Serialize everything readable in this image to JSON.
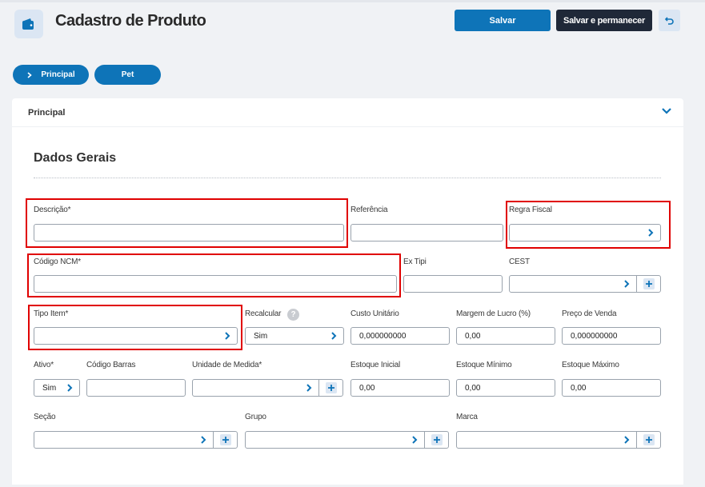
{
  "header": {
    "title": "Cadastro de Produto",
    "save_label": "Salvar",
    "save_stay_label": "Salvar e permanecer",
    "logo_icon": "wallet-icon",
    "back_icon": "undo-icon"
  },
  "tabs": [
    {
      "label": "Principal",
      "active": true
    },
    {
      "label": "Pet",
      "active": false
    }
  ],
  "section": {
    "label": "Principal",
    "title": "Dados Gerais"
  },
  "fields": {
    "descricao": {
      "label": "Descrição*",
      "value": ""
    },
    "referencia": {
      "label": "Referência",
      "value": ""
    },
    "regra_fiscal": {
      "label": "Regra Fiscal",
      "value": ""
    },
    "codigo_ncm": {
      "label": "Código NCM*",
      "value": ""
    },
    "ex_tipi": {
      "label": "Ex Tipi",
      "value": ""
    },
    "cest": {
      "label": "CEST",
      "value": ""
    },
    "tipo_item": {
      "label": "Tipo Item*",
      "value": ""
    },
    "recalcular": {
      "label": "Recalcular",
      "value": "Sim",
      "help": "?"
    },
    "custo_unitario": {
      "label": "Custo Unitário",
      "value": "0,000000000"
    },
    "margem_lucro": {
      "label": "Margem de Lucro (%)",
      "value": "0,00"
    },
    "preco_venda": {
      "label": "Preço de Venda",
      "value": "0,000000000"
    },
    "ativo": {
      "label": "Ativo*",
      "value": "Sim"
    },
    "codigo_barras": {
      "label": "Código Barras",
      "value": ""
    },
    "unidade_medida": {
      "label": "Unidade de Medida*",
      "value": ""
    },
    "estoque_inicial": {
      "label": "Estoque Inicial",
      "value": "0,00"
    },
    "estoque_minimo": {
      "label": "Estoque Mínimo",
      "value": "0,00"
    },
    "estoque_maximo": {
      "label": "Estoque Máximo",
      "value": "0,00"
    },
    "secao": {
      "label": "Seção",
      "value": ""
    },
    "grupo": {
      "label": "Grupo",
      "value": ""
    },
    "marca": {
      "label": "Marca",
      "value": ""
    }
  },
  "colors": {
    "primary": "#0e74b8",
    "dark": "#1f2838",
    "highlight": "#e00000"
  }
}
